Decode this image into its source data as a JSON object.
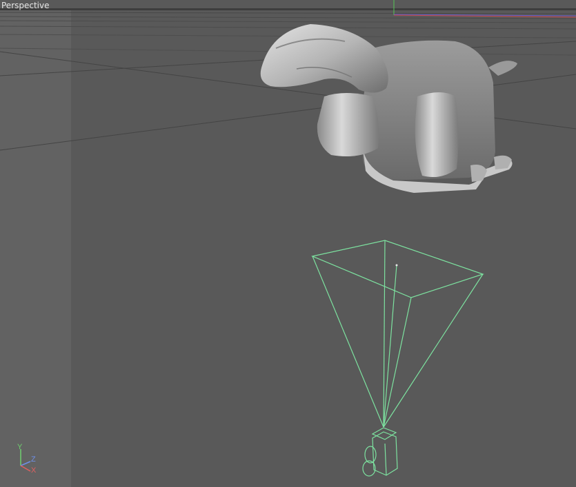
{
  "viewport": {
    "label": "Perspective",
    "colors": {
      "background": "#595959",
      "side_shade": "#626262",
      "grid_line": "#4a4a4a",
      "camera_wire": "#7de3a0",
      "model": "#bfbfbf"
    }
  },
  "axis_gizmo": {
    "y": "Y",
    "z": "Z",
    "x": "X",
    "colors": {
      "y": "#6fd06f",
      "z": "#6f8fe8",
      "x": "#e06060"
    }
  },
  "icons": {
    "camera": "camera-object-icon",
    "model": "mesh-object-icon"
  }
}
